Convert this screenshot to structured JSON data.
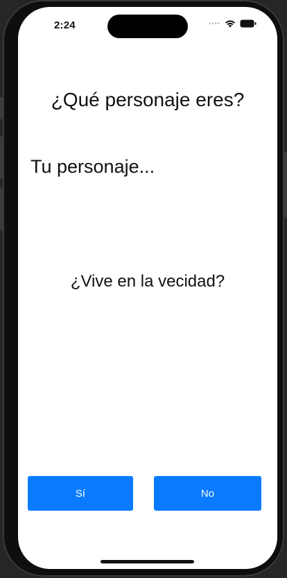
{
  "status_bar": {
    "time": "2:24",
    "signal_icon": "cellular-dots-icon",
    "wifi_icon": "wifi-icon",
    "battery_icon": "battery-icon"
  },
  "main": {
    "title": "¿Qué personaje eres?",
    "subtitle": "Tu personaje...",
    "question": "¿Vive en la vecidad?"
  },
  "buttons": {
    "yes_label": "Sí",
    "no_label": "No"
  },
  "colors": {
    "button_blue": "#0a7bff",
    "background": "#ffffff",
    "text": "#111111"
  }
}
